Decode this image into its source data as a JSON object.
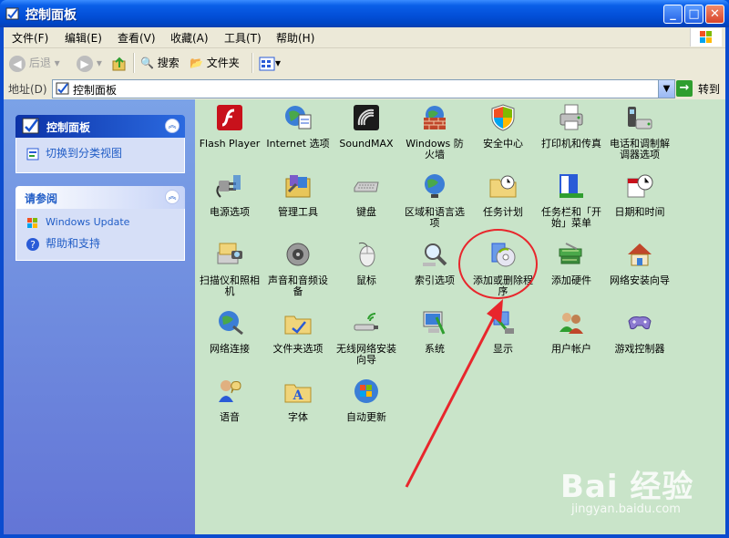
{
  "window": {
    "title": "控制面板"
  },
  "menu": {
    "items": [
      "文件(F)",
      "编辑(E)",
      "查看(V)",
      "收藏(A)",
      "工具(T)",
      "帮助(H)"
    ]
  },
  "toolbar": {
    "back": "后退",
    "search": "搜索",
    "folders": "文件夹"
  },
  "address": {
    "label": "地址(D)",
    "value": "控制面板",
    "go": "转到"
  },
  "sidebar": {
    "panel1": {
      "title": "控制面板",
      "link": "切换到分类视图"
    },
    "panel2": {
      "title": "请参阅",
      "links": [
        "Windows Update",
        "帮助和支持"
      ]
    }
  },
  "items": [
    "Flash Player",
    "Internet 选项",
    "SoundMAX",
    "Windows 防火墙",
    "安全中心",
    "打印机和传真",
    "电话和调制解调器选项",
    "电源选项",
    "管理工具",
    "键盘",
    "区域和语言选项",
    "任务计划",
    "任务栏和「开始」菜单",
    "日期和时间",
    "扫描仪和照相机",
    "声音和音频设备",
    "鼠标",
    "索引选项",
    "添加或删除程序",
    "添加硬件",
    "网络安装向导",
    "网络连接",
    "文件夹选项",
    "无线网络安装向导",
    "系统",
    "显示",
    "用户帐户",
    "游戏控制器",
    "语音",
    "字体",
    "自动更新"
  ],
  "watermark": {
    "brand": "Bai 经验",
    "url": "jingyan.baidu.com"
  },
  "colors": {
    "highlight_ring": "#e8262c",
    "content_bg": "#c9e4c9",
    "title_blue": "#0054e3"
  }
}
